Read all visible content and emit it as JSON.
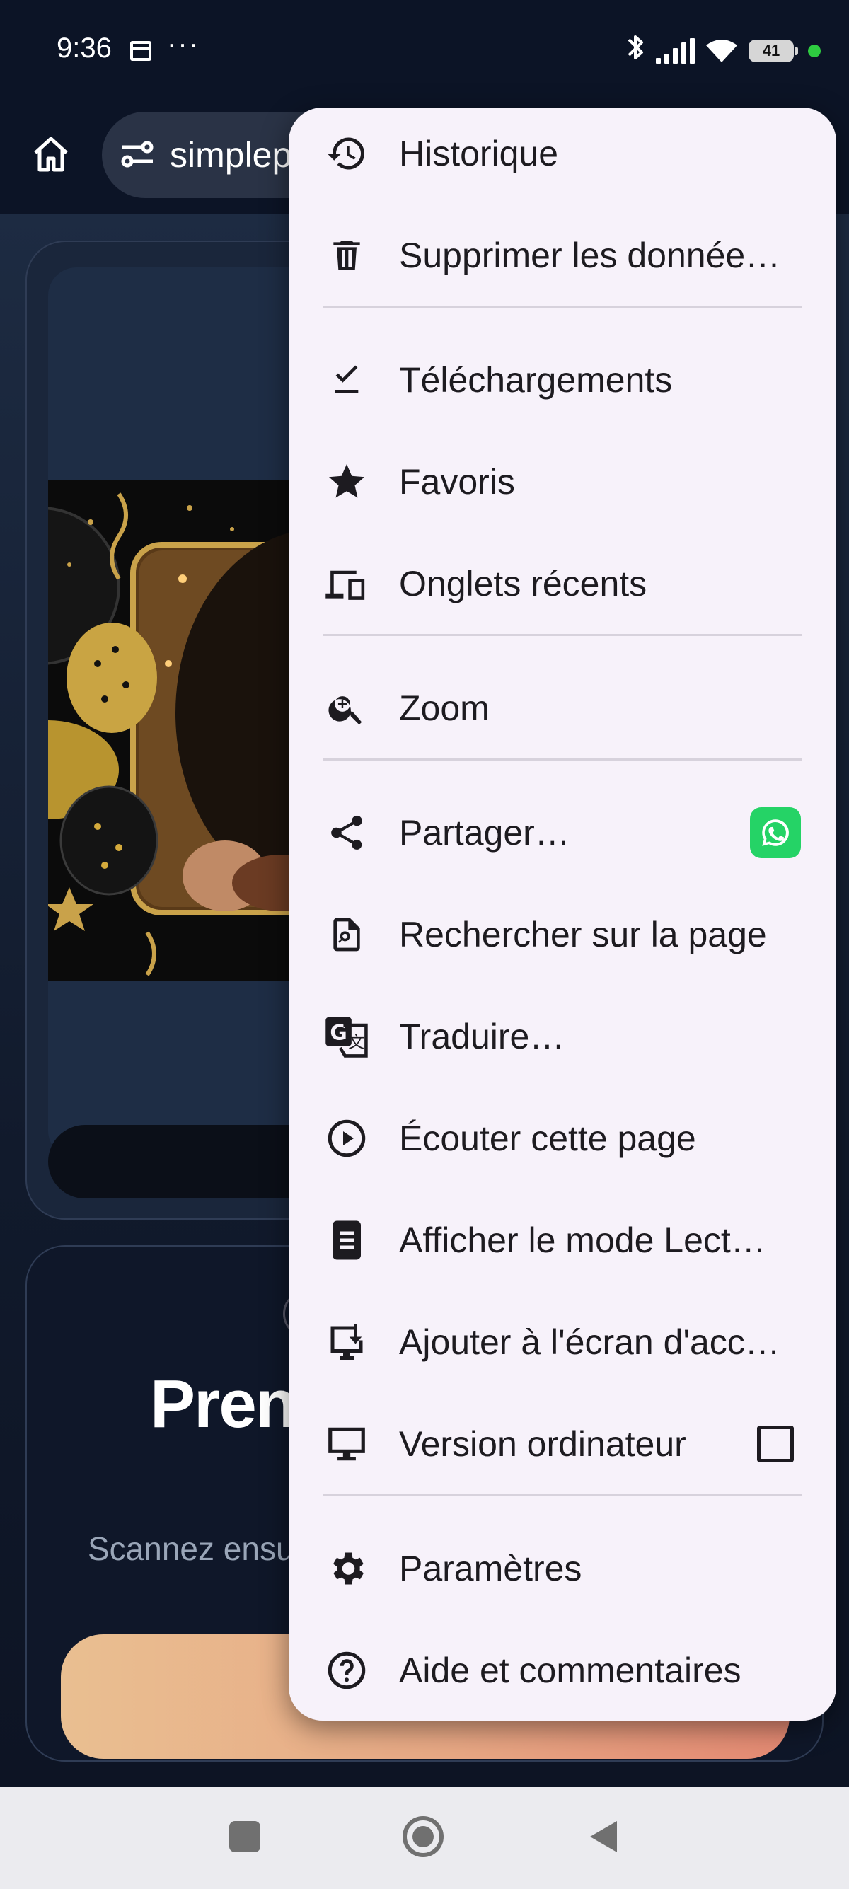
{
  "status_bar": {
    "time": "9:36",
    "dots": "···",
    "battery": "41"
  },
  "toolbar": {
    "url": "simplep"
  },
  "page": {
    "headline": "Pren",
    "subtext": "Scannez ensu"
  },
  "menu": {
    "items": [
      {
        "label": "Historique",
        "icon": "history-icon"
      },
      {
        "label": "Supprimer les donnée…",
        "icon": "trash-icon"
      },
      {
        "label": "Téléchargements",
        "icon": "download-done-icon"
      },
      {
        "label": "Favoris",
        "icon": "star-icon"
      },
      {
        "label": "Onglets récents",
        "icon": "devices-icon"
      },
      {
        "label": "Zoom",
        "icon": "zoom-in-icon"
      },
      {
        "label": "Partager…",
        "icon": "share-icon"
      },
      {
        "label": "Rechercher sur la page",
        "icon": "find-in-page-icon"
      },
      {
        "label": "Traduire…",
        "icon": "translate-icon"
      },
      {
        "label": "Écouter cette page",
        "icon": "play-circle-icon"
      },
      {
        "label": "Afficher le mode Lect…",
        "icon": "reader-mode-icon"
      },
      {
        "label": "Ajouter à l'écran d'acc…",
        "icon": "add-to-home-icon"
      },
      {
        "label": "Version ordinateur",
        "icon": "desktop-icon"
      },
      {
        "label": "Paramètres",
        "icon": "gear-icon"
      },
      {
        "label": "Aide et commentaires",
        "icon": "help-icon"
      }
    ],
    "desktop_checked": false
  },
  "colors": {
    "menu_bg": "#f7f2fa",
    "whatsapp": "#25d366",
    "cta_start": "#e9bf91",
    "cta_end": "#e58a73"
  }
}
